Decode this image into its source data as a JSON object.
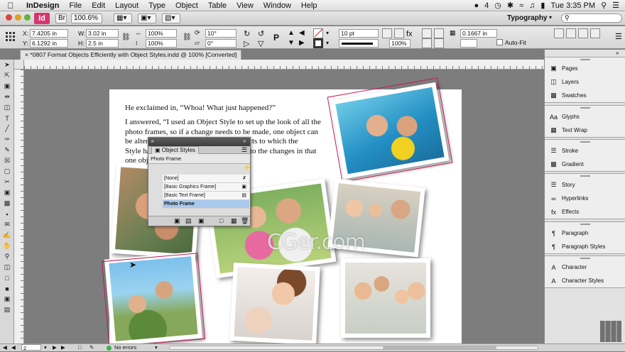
{
  "menubar": {
    "app_name": "InDesign",
    "items": [
      "File",
      "Edit",
      "Layout",
      "Type",
      "Object",
      "Table",
      "View",
      "Window",
      "Help"
    ],
    "status_extra": "4",
    "clock": "Tue 3:35 PM"
  },
  "appbar": {
    "logo": "Id",
    "zoom": "100.6%",
    "workspace": "Typography",
    "search_placeholder": ""
  },
  "control": {
    "x_label": "X:",
    "x_value": "7.4205 in",
    "y_label": "Y:",
    "y_value": "6.1292 in",
    "w_label": "W:",
    "w_value": "3.02 in",
    "h_label": "H:",
    "h_value": "2.5 in",
    "scale_x": "100%",
    "scale_y": "100%",
    "rotate": "10°",
    "shear": "0°",
    "stroke_weight": "10 pt",
    "opacity": "100%",
    "fit_offset": "0.1667 in",
    "autofit_label": "Auto-Fit"
  },
  "document": {
    "tab_title": "*0807 Format Objects Efficiently with Object Styles.indd @ 100% [Converted]",
    "paragraph1": "He exclaimed in, “Whoa! What just happened?”",
    "paragraph2_lines": [
      "I answered, “I used an Object Style to set up the look of all the",
      "photo frames, so if a change needs to be made, one object can",
      "be altered and it will update all the objects to which the",
      "Style has been applied, so they respond to the changes in that",
      "one object.”"
    ]
  },
  "object_styles_panel": {
    "title": "Object Styles",
    "current": "Photo Frame",
    "items": [
      "[None]",
      "[Basic Graphics Frame]",
      "[Basic Text Frame]",
      "Photo Frame"
    ],
    "selected_index": 3
  },
  "right_panel": {
    "groups": [
      [
        "Pages",
        "Layers",
        "Swatches"
      ],
      [
        "Glyphs",
        "Text Wrap"
      ],
      [
        "Stroke",
        "Gradient"
      ],
      [
        "Story",
        "Hyperlinks",
        "Effects"
      ],
      [
        "Paragraph",
        "Paragraph Styles"
      ],
      [
        "Character",
        "Character Styles"
      ]
    ]
  },
  "status": {
    "page": "2",
    "preflight": "No errors"
  },
  "watermark": "CGer.com",
  "colors": {
    "menubar_bg": "#e5e5e5",
    "indesign_pink": "#d6366e",
    "selection": "#a9c9ec",
    "pasteboard": "#7d7d7d",
    "frame_selection": "#c2185b"
  }
}
